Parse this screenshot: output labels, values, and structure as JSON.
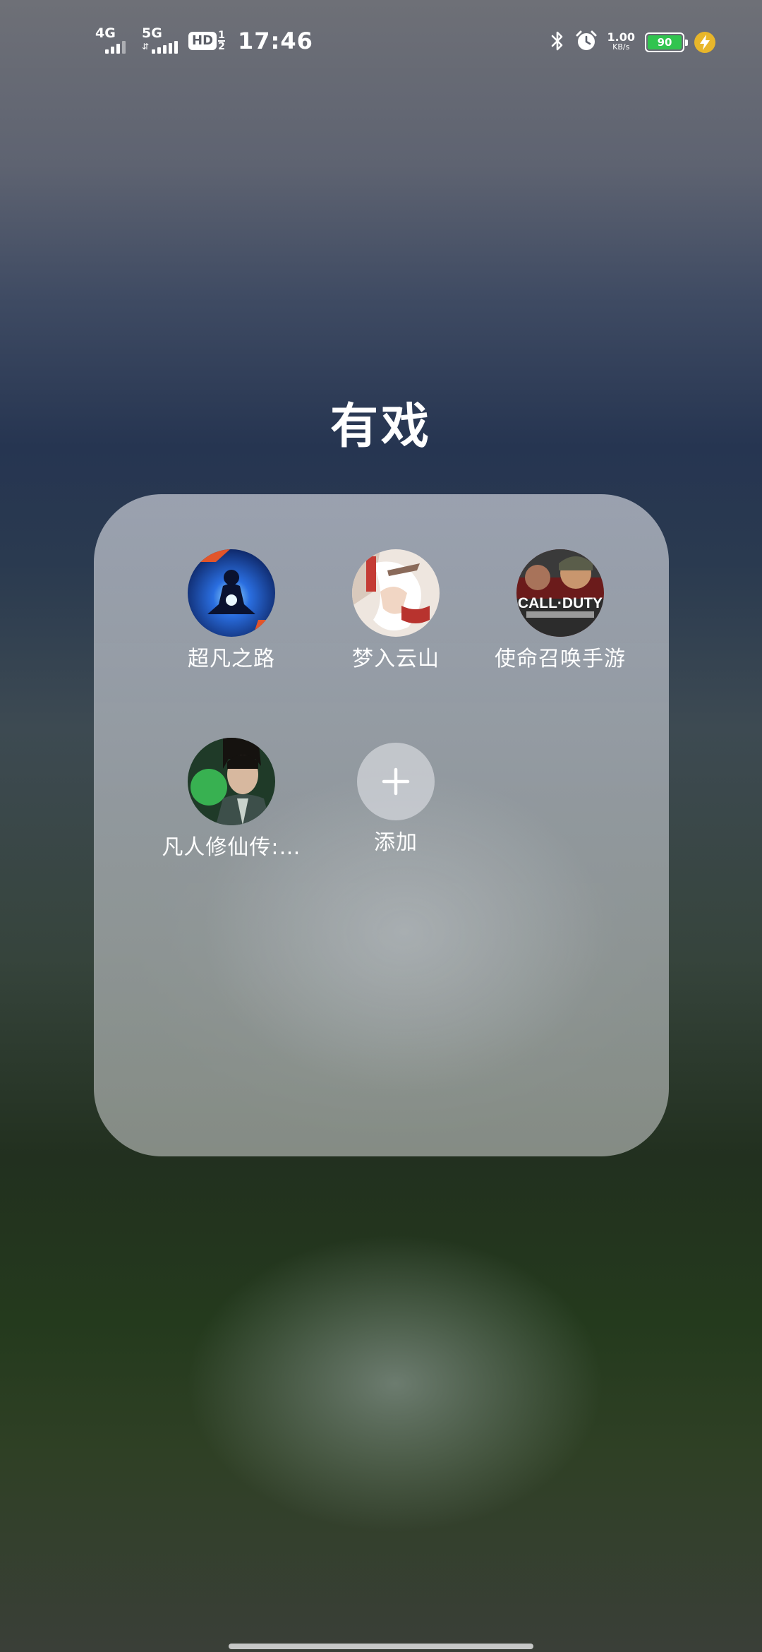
{
  "status_bar": {
    "sim1_network": "4G",
    "sim2_network": "5G",
    "hd_label": "HD",
    "hd_top": "1",
    "hd_bottom": "2",
    "time": "17:46",
    "net_speed_value": "1.00",
    "net_speed_unit": "KB/s",
    "battery_level": "90",
    "icons": [
      "bluetooth-icon",
      "alarm-icon",
      "charging-icon"
    ],
    "battery_color": "#31c44f"
  },
  "folder": {
    "title": "有戏",
    "apps": [
      {
        "label": "超凡之路",
        "icon": "chaofan-zhilu-app-icon"
      },
      {
        "label": "梦入云山",
        "icon": "mengru-yunshan-app-icon"
      },
      {
        "label": "使命召唤手游",
        "icon": "call-of-duty-app-icon",
        "icon_text": "CALL·DUTY"
      },
      {
        "label": "凡人修仙传:…",
        "icon": "fanren-xiuxian-app-icon"
      }
    ],
    "add_label": "添加"
  }
}
